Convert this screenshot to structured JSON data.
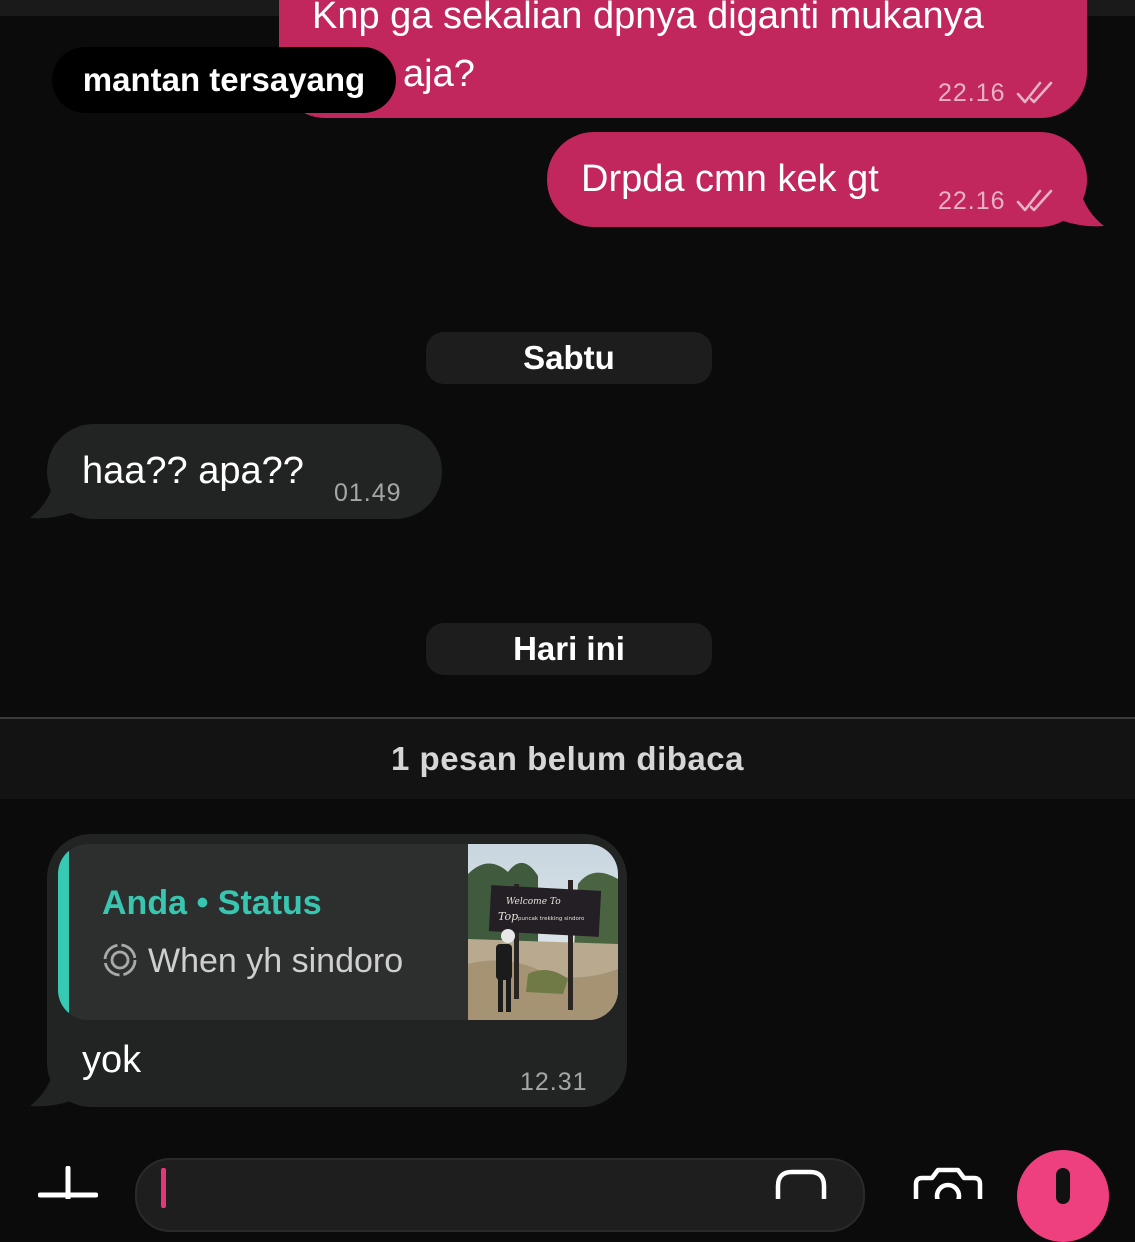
{
  "contact": {
    "name": "mantan tersayang"
  },
  "messages": {
    "m1": {
      "text_line1": "Knp ga sekalian dpnya diganti mukanya",
      "text_line2": "aja?",
      "time": "22.16",
      "status": "read"
    },
    "m2": {
      "text": "Drpda cmn kek gt",
      "time": "22.16",
      "status": "read"
    },
    "m3": {
      "text": "haa?? apa??",
      "time": "01.49"
    },
    "m4": {
      "quote_author": "Anda • Status",
      "quote_text": "When yh sindoro",
      "thumb_sign_line1": "Welcome To",
      "thumb_sign_line2": "Top",
      "thumb_sign_line3": "puncak trekking sindoro",
      "text": "yok",
      "time": "12.31"
    }
  },
  "dates": {
    "d1": "Sabtu",
    "d2": "Hari ini"
  },
  "unread": {
    "label": "1 pesan belum dibaca"
  },
  "icons": {
    "read": "double-check-icon",
    "status": "status-ring-icon",
    "add": "plus-icon",
    "sticker": "sticker-icon",
    "camera": "camera-icon",
    "mic": "microphone-icon"
  },
  "colors": {
    "outgoing_bubble": "#c1275d",
    "incoming_bubble": "#222323",
    "accent": "#38c9b3",
    "mic": "#ee3f7f"
  }
}
